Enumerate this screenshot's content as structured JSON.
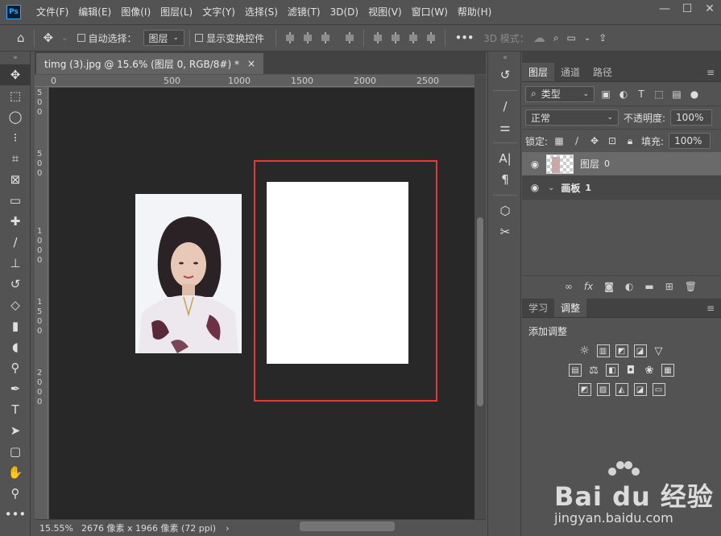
{
  "app": {
    "logo_text": "Ps",
    "menu": [
      "文件(F)",
      "编辑(E)",
      "图像(I)",
      "图层(L)",
      "文字(Y)",
      "选择(S)",
      "滤镜(T)",
      "3D(D)",
      "视图(V)",
      "窗口(W)",
      "帮助(H)"
    ],
    "window_controls": {
      "minimize": "—",
      "maximize": "☐",
      "close": "✕"
    }
  },
  "options_bar": {
    "home_icon": "home-icon",
    "move_icon": "move-icon",
    "auto_select_label": "自动选择：",
    "auto_select_value": "图层",
    "show_transform_label": "显示变换控件",
    "more_label": "•••",
    "mode_3d_label": "3D 模式："
  },
  "document": {
    "tab_title": "timg (3).jpg @ 15.6% (图层 0, RGB/8#) *",
    "tab_close": "×",
    "ruler_labels": [
      "0",
      "500",
      "1000",
      "1500",
      "2000",
      "2500"
    ],
    "ruler_v_labels": [
      "5",
      "0",
      "0",
      "5",
      "0",
      "0",
      "1",
      "0",
      "0",
      "0",
      "1",
      "5",
      "0",
      "0",
      "2",
      "0",
      "0",
      "0"
    ]
  },
  "status": {
    "zoom": "15.55%",
    "doc_info": "2676 像素 x 1966 像素 (72 ppi)",
    "arrow": "›"
  },
  "layers_panel": {
    "tabs": [
      "图层",
      "通道",
      "路径"
    ],
    "filter_label": "类型",
    "blend_mode": "正常",
    "opacity_label": "不透明度:",
    "opacity_value": "100%",
    "lock_label": "锁定:",
    "fill_label": "填充:",
    "fill_value": "100%",
    "layers": [
      {
        "name": "图层",
        "suffix": "0",
        "selected": true
      },
      {
        "name": "画板",
        "suffix": "1",
        "selected": false,
        "group": true
      }
    ]
  },
  "adjust_panel": {
    "tabs": [
      "学习",
      "调整"
    ],
    "heading": "添加调整"
  },
  "watermark": {
    "logo": "Bai du 经验",
    "url": "jingyan.baidu.com"
  },
  "colors": {
    "selection_border": "#e53935",
    "canvas_bg": "#282828",
    "ui_bg": "#535353"
  }
}
